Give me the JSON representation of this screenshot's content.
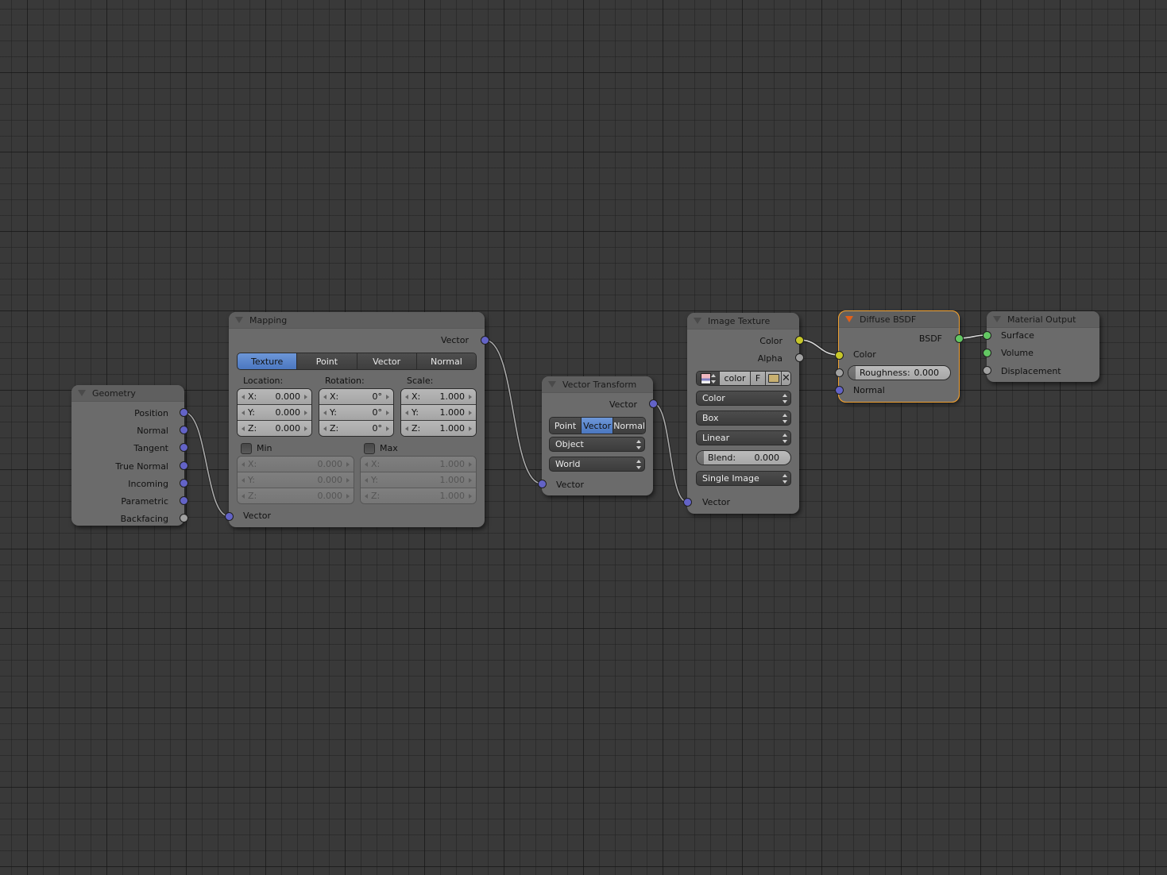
{
  "editor": "Node Editor",
  "colors": {
    "background": "#393939",
    "node_body": "#6b6b6b",
    "socket_vector": "#6363c7",
    "socket_color": "#c7c729",
    "socket_float": "#a1a1a1",
    "socket_shader": "#63c763",
    "active_outline": "#e89a2b",
    "selected_button": "#5680c8"
  },
  "nodes": {
    "geometry": {
      "title": "Geometry",
      "outputs": [
        "Position",
        "Normal",
        "Tangent",
        "True Normal",
        "Incoming",
        "Parametric",
        "Backfacing"
      ]
    },
    "mapping": {
      "title": "Mapping",
      "output": "Vector",
      "type_buttons": [
        "Texture",
        "Point",
        "Vector",
        "Normal"
      ],
      "selected_type": "Texture",
      "location": {
        "label": "Location:",
        "x": "0.000",
        "y": "0.000",
        "z": "0.000"
      },
      "rotation": {
        "label": "Rotation:",
        "x": "0°",
        "y": "0°",
        "z": "0°"
      },
      "scale": {
        "label": "Scale:",
        "x": "1.000",
        "y": "1.000",
        "z": "1.000"
      },
      "min": {
        "label": "Min",
        "checked": false,
        "x": "0.000",
        "y": "0.000",
        "z": "0.000"
      },
      "max": {
        "label": "Max",
        "checked": false,
        "x": "1.000",
        "y": "1.000",
        "z": "1.000"
      },
      "axis_labels": {
        "x": "X:",
        "y": "Y:",
        "z": "Z:"
      },
      "input": "Vector"
    },
    "vector_transform": {
      "title": "Vector Transform",
      "output": "Vector",
      "type_buttons": [
        "Point",
        "Vector",
        "Normal"
      ],
      "selected_type": "Vector",
      "convert_from": "Object",
      "convert_to": "World",
      "input": "Vector"
    },
    "image_texture": {
      "title": "Image Texture",
      "outputs": [
        "Color",
        "Alpha"
      ],
      "image_name": "color",
      "fake_user": "F",
      "color_space": "Color",
      "projection": "Box",
      "interpolation": "Linear",
      "blend": {
        "label": "Blend:",
        "value": "0.000"
      },
      "source": "Single Image",
      "input": "Vector"
    },
    "diffuse_bsdf": {
      "title": "Diffuse BSDF",
      "output": "BSDF",
      "inputs": {
        "color": "Color",
        "normal": "Normal"
      },
      "roughness": {
        "label": "Roughness:",
        "value": "0.000"
      }
    },
    "material_output": {
      "title": "Material Output",
      "inputs": [
        "Surface",
        "Volume",
        "Displacement"
      ]
    }
  },
  "links": [
    {
      "from": "Geometry.Position",
      "to": "Mapping.Vector"
    },
    {
      "from": "Mapping.Vector",
      "to": "Vector Transform.Vector"
    },
    {
      "from": "Vector Transform.Vector",
      "to": "Image Texture.Vector"
    },
    {
      "from": "Image Texture.Color",
      "to": "Diffuse BSDF.Color"
    },
    {
      "from": "Diffuse BSDF.BSDF",
      "to": "Material Output.Surface"
    }
  ]
}
